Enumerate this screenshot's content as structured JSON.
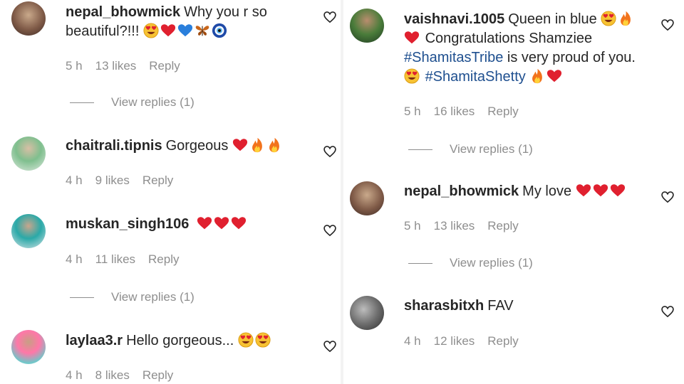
{
  "left": {
    "comments": [
      {
        "username": "nepal_bhowmick",
        "text": "Why you r so beautiful?!!!",
        "time": "5 h",
        "likes": "13 likes",
        "reply": "Reply",
        "view_replies": "View replies (1)"
      },
      {
        "username": "chaitrali.tipnis",
        "text": "Gorgeous",
        "time": "4 h",
        "likes": "9 likes",
        "reply": "Reply"
      },
      {
        "username": "muskan_singh106",
        "text": "",
        "time": "4 h",
        "likes": "11 likes",
        "reply": "Reply",
        "view_replies": "View replies (1)"
      },
      {
        "username": "laylaa3.r",
        "text": "Hello gorgeous...",
        "time": "4 h",
        "likes": "8 likes",
        "reply": "Reply"
      }
    ]
  },
  "right": {
    "comments": [
      {
        "username": "vaishnavi.1005",
        "text_a": "Queen in blue",
        "text_b": "Congratulations Shamziee",
        "hashtag1": "#ShamitasTribe",
        "text_c": "is very proud of you.",
        "hashtag2": "#ShamitaShetty",
        "time": "5 h",
        "likes": "16 likes",
        "reply": "Reply",
        "view_replies": "View replies (1)"
      },
      {
        "username": "nepal_bhowmick",
        "text": "My love",
        "time": "5 h",
        "likes": "13 likes",
        "reply": "Reply",
        "view_replies": "View replies (1)"
      },
      {
        "username": "sharasbitxh",
        "text": "FAV",
        "time": "4 h",
        "likes": "12 likes",
        "reply": "Reply"
      }
    ]
  },
  "icons": [
    "heart-outline-icon",
    "red-heart-emoji",
    "blue-heart-emoji",
    "butterfly-emoji",
    "nazar-amulet-emoji",
    "heart-eyes-emoji",
    "fire-emoji"
  ],
  "colors": {
    "text": "#262626",
    "meta": "#8e8e8e",
    "hashtag": "#1e4f8f",
    "heart": "#e0202f"
  }
}
